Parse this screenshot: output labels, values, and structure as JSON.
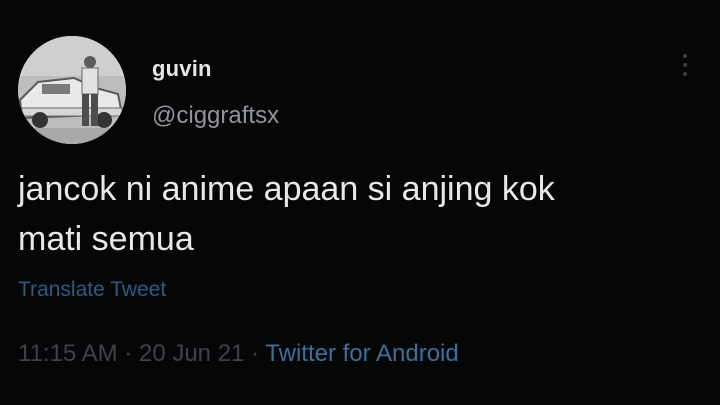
{
  "tweet": {
    "display_name": "guvin",
    "handle": "@ciggraftsx",
    "line_1": "jancok ni anime apaan si anjing kok",
    "line_2": "mati semua",
    "translate_label": "Translate Tweet",
    "time": "11:15 AM",
    "separator_1": "·",
    "date": "20 Jun 21",
    "separator_2": "·",
    "client": "Twitter for Android"
  },
  "icons": {
    "more": "more-vertical-icon",
    "avatar": "profile-avatar"
  },
  "colors": {
    "background": "#060606",
    "name": "#e6e6e6",
    "handle": "#8f959a",
    "link": "#2b5a83",
    "meta": "#3f4245"
  }
}
